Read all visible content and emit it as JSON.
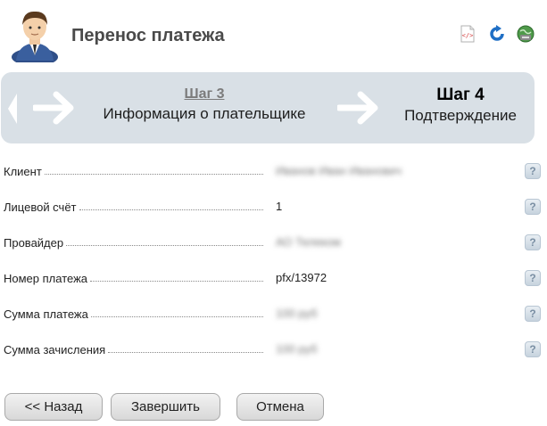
{
  "header": {
    "title": "Перенос платежа",
    "icons": [
      "user-avatar-icon",
      "code-icon",
      "refresh-icon",
      "globe-icon"
    ]
  },
  "steps": {
    "previous": {
      "title": "Шаг 3",
      "description": "Информация о плательщике"
    },
    "current": {
      "title": "Шаг 4",
      "description": "Подтверждение"
    }
  },
  "rows": [
    {
      "label": "Клиент",
      "value": "Иванов Иван Иванович",
      "blurred": true
    },
    {
      "label": "Лицевой счёт",
      "value": "1",
      "blurred": false
    },
    {
      "label": "Провайдер",
      "value": "АО Телеком",
      "blurred": true
    },
    {
      "label": "Номер платежа",
      "value": "pfx/13972",
      "blurred": false
    },
    {
      "label": "Сумма платежа",
      "value": "100 руб",
      "blurred": true
    },
    {
      "label": "Сумма зачисления",
      "value": "100 руб",
      "blurred": true
    }
  ],
  "help_label": "?",
  "buttons": {
    "back": "<< Назад",
    "finish": "Завершить",
    "cancel": "Отмена"
  },
  "colors": {
    "banner_bg": "#d9e0e6",
    "button_border": "#a9a9a9",
    "help_icon": "#7a8fa3"
  }
}
